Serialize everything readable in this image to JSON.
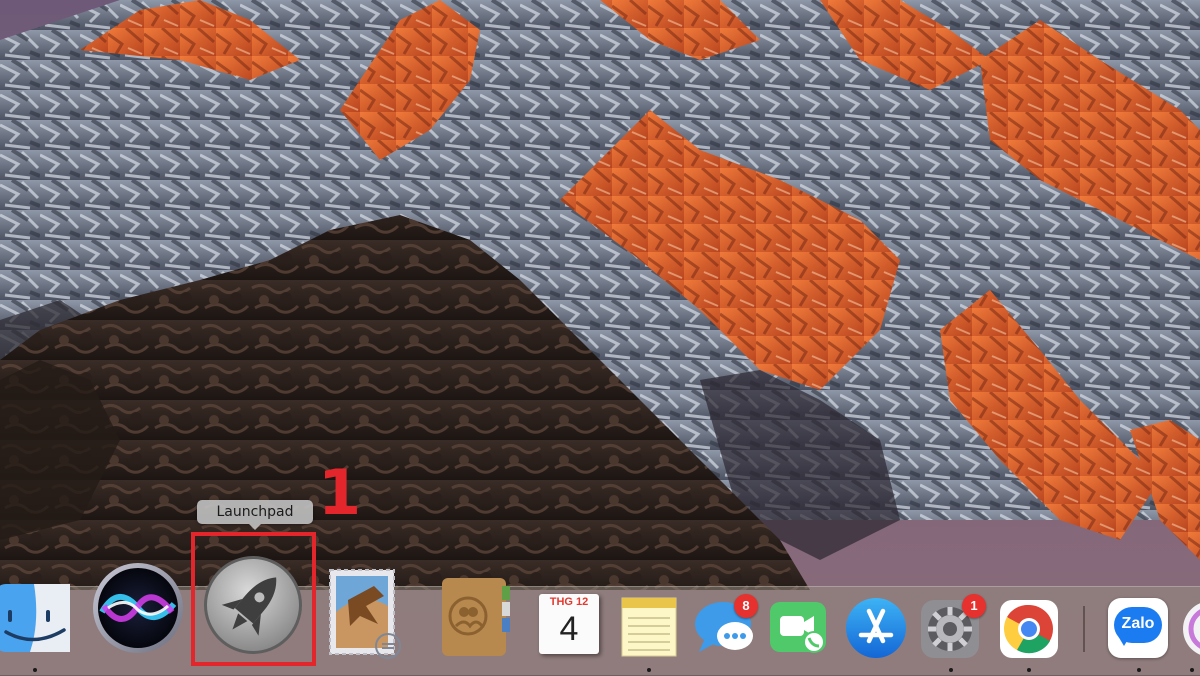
{
  "tooltip": {
    "label": "Launchpad"
  },
  "annotation": {
    "step": "1",
    "highlight_color": "#e3262c"
  },
  "dock": {
    "items": [
      {
        "name": "Finder",
        "icon": "finder-icon",
        "running": true
      },
      {
        "name": "Siri",
        "icon": "siri-icon",
        "running": false
      },
      {
        "name": "Launchpad",
        "icon": "launchpad-rocket-icon",
        "running": false,
        "highlighted": true
      },
      {
        "name": "Mail",
        "icon": "mail-stamp-icon",
        "running": false
      },
      {
        "name": "Contacts",
        "icon": "contacts-book-icon",
        "running": false
      },
      {
        "name": "Calendar",
        "icon": "calendar-icon",
        "month": "THG 12",
        "day": "4",
        "running": false
      },
      {
        "name": "Notes",
        "icon": "notes-icon",
        "running": true
      },
      {
        "name": "Messages",
        "icon": "messages-icon",
        "badge": "8",
        "running": false
      },
      {
        "name": "FaceTime",
        "icon": "facetime-icon",
        "running": false
      },
      {
        "name": "App Store",
        "icon": "app-store-icon",
        "running": false
      },
      {
        "name": "System Preferences",
        "icon": "gear-icon",
        "badge": "1",
        "running": true
      },
      {
        "name": "Google Chrome",
        "icon": "chrome-icon",
        "running": true
      },
      {
        "name": "Zalo",
        "icon": "zalo-icon",
        "label": "Zalo",
        "running": true
      },
      {
        "name": "Partial app",
        "icon": "partial-app-icon",
        "running": false
      }
    ]
  }
}
